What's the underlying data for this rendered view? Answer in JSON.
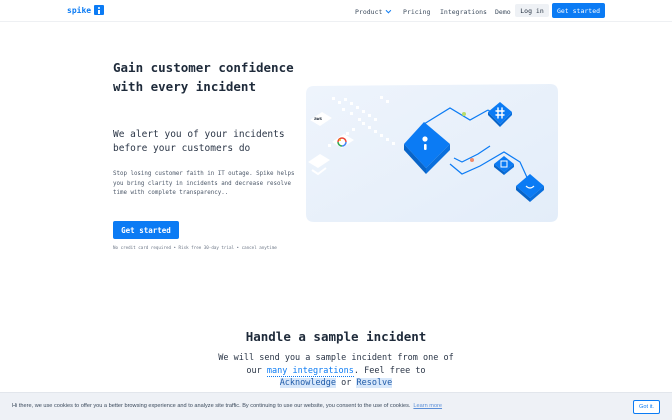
{
  "nav": {
    "logo_text": "spike",
    "links": {
      "product": "Product",
      "pricing": "Pricing",
      "integrations": "Integrations",
      "demo": "Demo"
    },
    "login_label": "Log in",
    "get_started_label": "Get started"
  },
  "hero": {
    "title": "Gain customer confidence with every incident",
    "subtitle": "We alert you of your incidents before your customers do",
    "description": "Stop losing customer faith in IT outage. Spike helps you bring clarity in incidents and decrease resolve time with complete transparency..",
    "cta_label": "Get started",
    "fine_print": "No credit card required • Risk free 30-day trial • cancel anytime",
    "aws_badge": "aws"
  },
  "sample": {
    "title": "Handle a sample incident",
    "text_before": "We will send you a sample incident from one of our ",
    "link_text": "many integrations",
    "text_middle": ". Feel free to ",
    "acknowledge": "Acknowledge",
    "or": " or ",
    "resolve": "Resolve"
  },
  "cookie": {
    "text": "Hi there, we use cookies to offer you a better browsing experience and to analyze site traffic. By continuing to use our website, you consent to the use of cookies.",
    "learn_more": "Learn more",
    "button_label": "Got it."
  },
  "colors": {
    "brand": "#0b7bf4",
    "illustration_bg": "#e9f1fb",
    "cookie_bg": "#eef1f6"
  },
  "icons": [
    "spike-logo-icon",
    "chevron-down-icon",
    "aws-icon",
    "google-cloud-icon",
    "slack-icon",
    "spike-cube-icon"
  ]
}
